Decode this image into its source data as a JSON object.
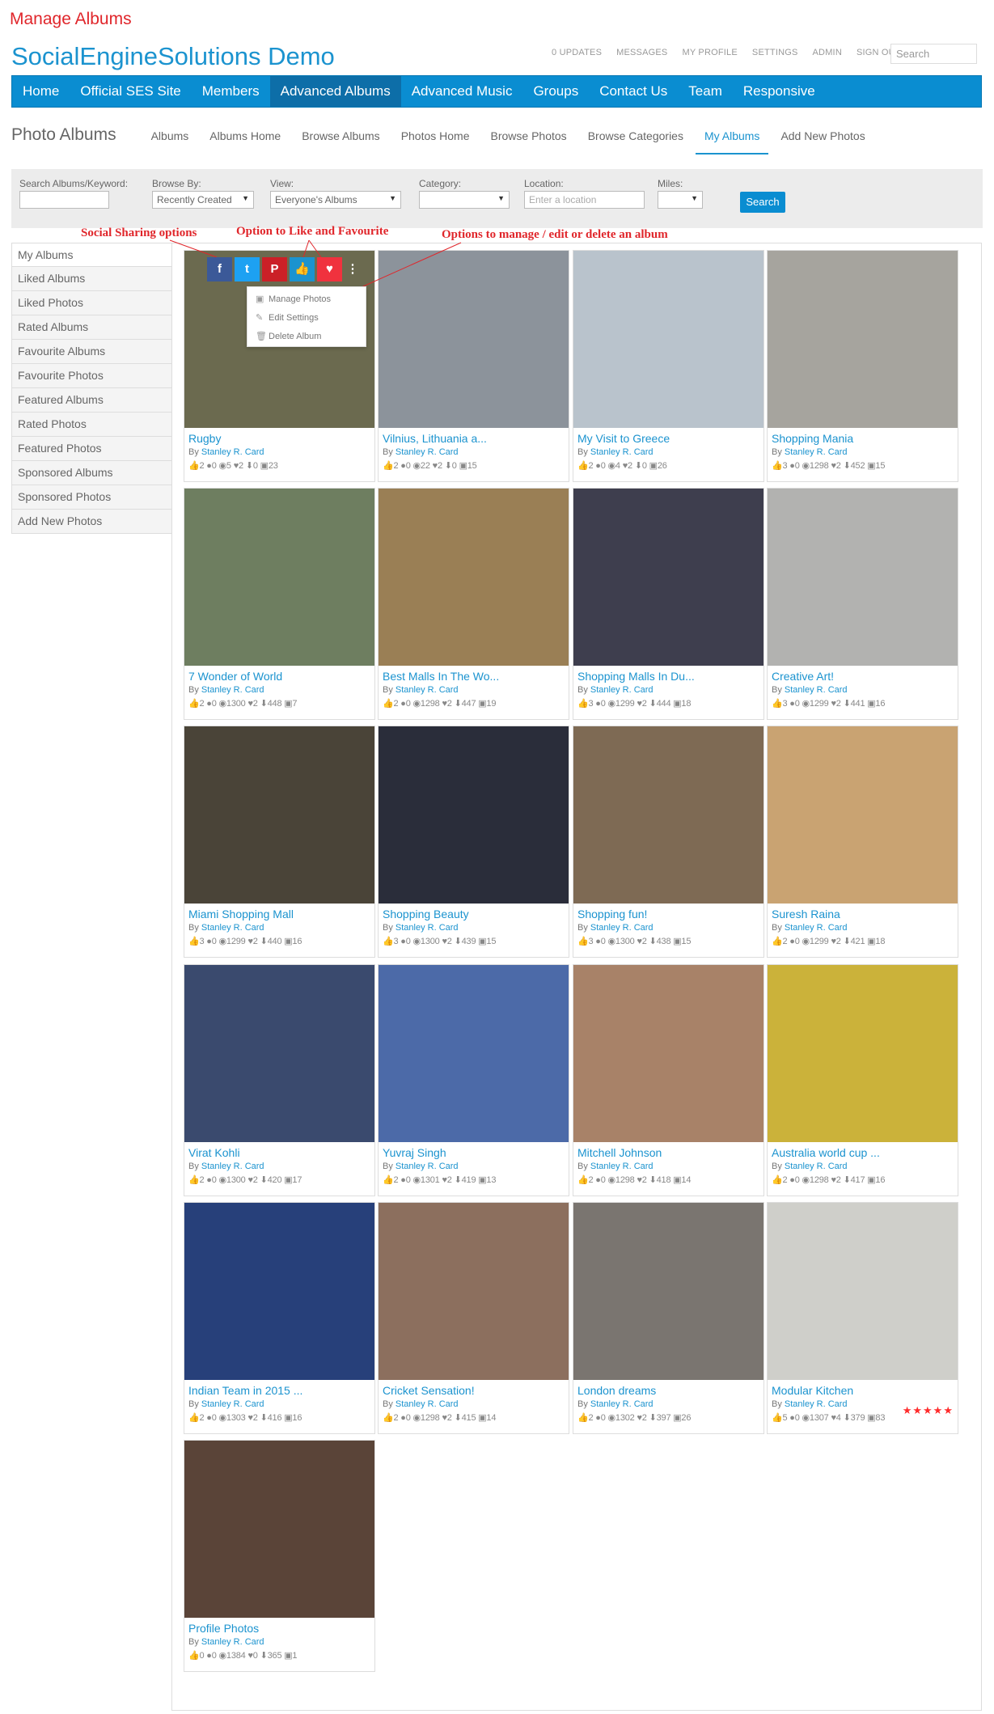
{
  "page_heading": "Manage Albums",
  "site_title": "SocialEngineSolutions Demo",
  "mini_menu": [
    "0 UPDATES",
    "MESSAGES",
    "MY PROFILE",
    "SETTINGS",
    "ADMIN",
    "SIGN OUT"
  ],
  "mini_search_placeholder": "Search",
  "main_nav": [
    {
      "label": "Home",
      "active": false
    },
    {
      "label": "Official SES Site",
      "active": false
    },
    {
      "label": "Members",
      "active": false
    },
    {
      "label": "Advanced Albums",
      "active": true
    },
    {
      "label": "Advanced Music",
      "active": false
    },
    {
      "label": "Groups",
      "active": false
    },
    {
      "label": "Contact Us",
      "active": false
    },
    {
      "label": "Team",
      "active": false
    },
    {
      "label": "Responsive",
      "active": false
    }
  ],
  "subnav": {
    "title": "Photo Albums",
    "items": [
      {
        "label": "Albums",
        "active": false
      },
      {
        "label": "Albums Home",
        "active": false
      },
      {
        "label": "Browse Albums",
        "active": false
      },
      {
        "label": "Photos Home",
        "active": false
      },
      {
        "label": "Browse Photos",
        "active": false
      },
      {
        "label": "Browse Categories",
        "active": false
      },
      {
        "label": "My Albums",
        "active": true
      },
      {
        "label": "Add New Photos",
        "active": false
      }
    ]
  },
  "filters": {
    "keyword_label": "Search Albums/Keyword:",
    "keyword_value": "",
    "browse_label": "Browse By:",
    "browse_value": "Recently Created",
    "view_label": "View:",
    "view_value": "Everyone's Albums",
    "category_label": "Category:",
    "category_value": "",
    "location_label": "Location:",
    "location_placeholder": "Enter a location",
    "miles_label": "Miles:",
    "miles_value": "",
    "search_button": "Search"
  },
  "sidebar": [
    "My Albums",
    "Liked Albums",
    "Liked Photos",
    "Rated Albums",
    "Favourite Albums",
    "Favourite Photos",
    "Featured Albums",
    "Rated Photos",
    "Featured Photos",
    "Sponsored Albums",
    "Sponsored Photos",
    "Add New Photos"
  ],
  "annotations": {
    "social": "Social Sharing options",
    "like": "Option to Like and Favourite",
    "manage": "Options to manage / edit or delete an album"
  },
  "dropdown": [
    "Manage Photos",
    "Edit Settings",
    "Delete Album"
  ],
  "owner_prefix": "By",
  "owner": "Stanley R. Card",
  "icons": {
    "like": "thumb-up-icon",
    "comment": "comment-icon",
    "view": "eye-icon",
    "favourite": "heart-icon",
    "download": "download-icon",
    "photos": "photo-count-icon"
  },
  "colors": {
    "accent": "#0a8dd1",
    "link": "#1b93cf",
    "annotation": "#e0262b",
    "facebook": "#3b5998",
    "twitter": "#1da1f2",
    "pinterest": "#cb2027",
    "like": "#1b93cf",
    "favourite": "#f0323e"
  },
  "albums": [
    {
      "title": "Rugby",
      "stats": [
        "2",
        "0",
        "5",
        "2",
        "0",
        "23"
      ],
      "thumb": "#6b6a4f"
    },
    {
      "title": "Vilnius, Lithuania a...",
      "stats": [
        "2",
        "0",
        "22",
        "2",
        "0",
        "15"
      ],
      "thumb": "#8c939b"
    },
    {
      "title": "My Visit to Greece",
      "stats": [
        "2",
        "0",
        "4",
        "2",
        "0",
        "26"
      ],
      "thumb": "#b9c3cc"
    },
    {
      "title": "Shopping Mania",
      "stats": [
        "3",
        "0",
        "1298",
        "2",
        "452",
        "15"
      ],
      "thumb": "#a6a49e"
    },
    {
      "title": "7 Wonder of World",
      "stats": [
        "2",
        "0",
        "1300",
        "2",
        "448",
        "7"
      ],
      "thumb": "#6e7e60"
    },
    {
      "title": "Best Malls In The Wo...",
      "stats": [
        "2",
        "0",
        "1298",
        "2",
        "447",
        "19"
      ],
      "thumb": "#9a7f55"
    },
    {
      "title": "Shopping Malls In Du...",
      "stats": [
        "3",
        "0",
        "1299",
        "2",
        "444",
        "18"
      ],
      "thumb": "#3e3e4e"
    },
    {
      "title": "Creative Art!",
      "stats": [
        "3",
        "0",
        "1299",
        "2",
        "441",
        "16"
      ],
      "thumb": "#b2b2b0"
    },
    {
      "title": "Miami Shopping Mall",
      "stats": [
        "3",
        "0",
        "1299",
        "2",
        "440",
        "16"
      ],
      "thumb": "#4a4438"
    },
    {
      "title": "Shopping Beauty",
      "stats": [
        "3",
        "0",
        "1300",
        "2",
        "439",
        "15"
      ],
      "thumb": "#2a2d3a"
    },
    {
      "title": "Shopping fun!",
      "stats": [
        "3",
        "0",
        "1300",
        "2",
        "438",
        "15"
      ],
      "thumb": "#7e6a54"
    },
    {
      "title": "Suresh Raina",
      "stats": [
        "2",
        "0",
        "1299",
        "2",
        "421",
        "18"
      ],
      "thumb": "#c9a372"
    },
    {
      "title": "Virat Kohli",
      "stats": [
        "2",
        "0",
        "1300",
        "2",
        "420",
        "17"
      ],
      "thumb": "#3a4a6e"
    },
    {
      "title": "Yuvraj Singh",
      "stats": [
        "2",
        "0",
        "1301",
        "2",
        "419",
        "13"
      ],
      "thumb": "#4c6aa8"
    },
    {
      "title": "Mitchell Johnson",
      "stats": [
        "2",
        "0",
        "1298",
        "2",
        "418",
        "14"
      ],
      "thumb": "#a88268"
    },
    {
      "title": "Australia world cup ...",
      "stats": [
        "2",
        "0",
        "1298",
        "2",
        "417",
        "16"
      ],
      "thumb": "#cbb23a"
    },
    {
      "title": "Indian Team in 2015 ...",
      "stats": [
        "2",
        "0",
        "1303",
        "2",
        "416",
        "16"
      ],
      "thumb": "#27407a"
    },
    {
      "title": "Cricket Sensation!",
      "stats": [
        "2",
        "0",
        "1298",
        "2",
        "415",
        "14"
      ],
      "thumb": "#8c6f5e"
    },
    {
      "title": "London dreams",
      "stats": [
        "2",
        "0",
        "1302",
        "2",
        "397",
        "26"
      ],
      "thumb": "#7a7570"
    },
    {
      "title": "Modular Kitchen",
      "stats": [
        "5",
        "0",
        "1307",
        "4",
        "379",
        "83"
      ],
      "thumb": "#cfcfca",
      "rating": 5
    },
    {
      "title": "Profile Photos",
      "stats": [
        "0",
        "0",
        "1384",
        "0",
        "365",
        "1"
      ],
      "thumb": "#5a4438"
    }
  ]
}
